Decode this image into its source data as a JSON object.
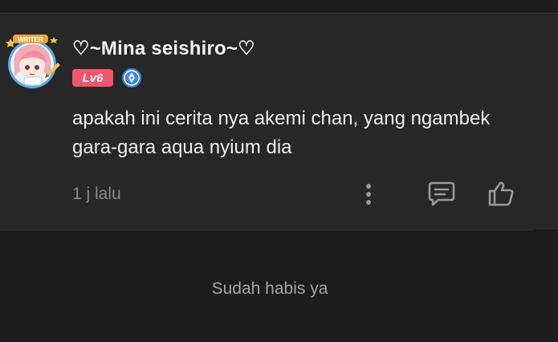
{
  "comment": {
    "username": "♡~Mina seishiro~♡",
    "avatar_badge_text": "WRITER",
    "avatar_icon": "anime-girl-avatar-icon",
    "level_label": "Lv6",
    "verified_icon": "writer-pen-badge-icon",
    "text": "apakah ini cerita nya akemi chan, yang ngambek gara-gara aqua nyium dia",
    "timestamp": "1 j lalu",
    "actions": {
      "more_icon": "more-vertical-icon",
      "reply_icon": "comment-reply-icon",
      "like_icon": "thumbs-up-icon"
    }
  },
  "footer": {
    "end_text": "Sudah habis ya"
  },
  "colors": {
    "background": "#1c1c1c",
    "card": "#272727",
    "level_badge": "#f2546f",
    "verified_badge": "#3d86e6",
    "muted_text": "#8a8a8a"
  }
}
